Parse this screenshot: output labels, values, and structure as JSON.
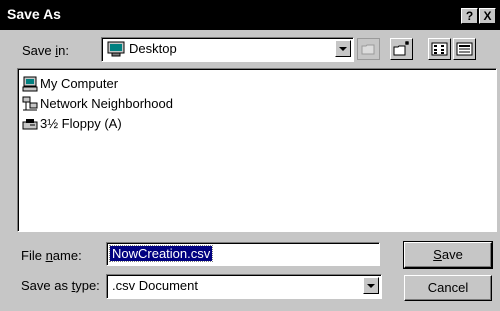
{
  "window": {
    "title": "Save As",
    "help_glyph": "?",
    "close_glyph": "X"
  },
  "save_in": {
    "label_before": "Save ",
    "label_accel": "i",
    "label_after": "n:",
    "value": "Desktop",
    "icon": "desktop-icon"
  },
  "toolbar": {
    "up_folder_icon": "up-one-level-icon",
    "new_folder_icon": "new-folder-icon",
    "list_view_icon": "list-view-icon",
    "details_view_icon": "details-view-icon"
  },
  "file_list": {
    "items": [
      {
        "label": "My Computer",
        "icon": "my-computer-icon"
      },
      {
        "label": "Network Neighborhood",
        "icon": "network-icon"
      },
      {
        "label": "3½ Floppy (A)",
        "icon": "floppy-drive-icon"
      }
    ]
  },
  "file_name": {
    "label_before": "File ",
    "label_accel": "n",
    "label_after": "ame:",
    "value": "NowCreation.csv"
  },
  "save_as_type": {
    "label_before": "Save as ",
    "label_accel": "t",
    "label_after": "ype:",
    "value": ".csv Document"
  },
  "buttons": {
    "save_accel": "S",
    "save_rest": "ave",
    "cancel": "Cancel"
  }
}
